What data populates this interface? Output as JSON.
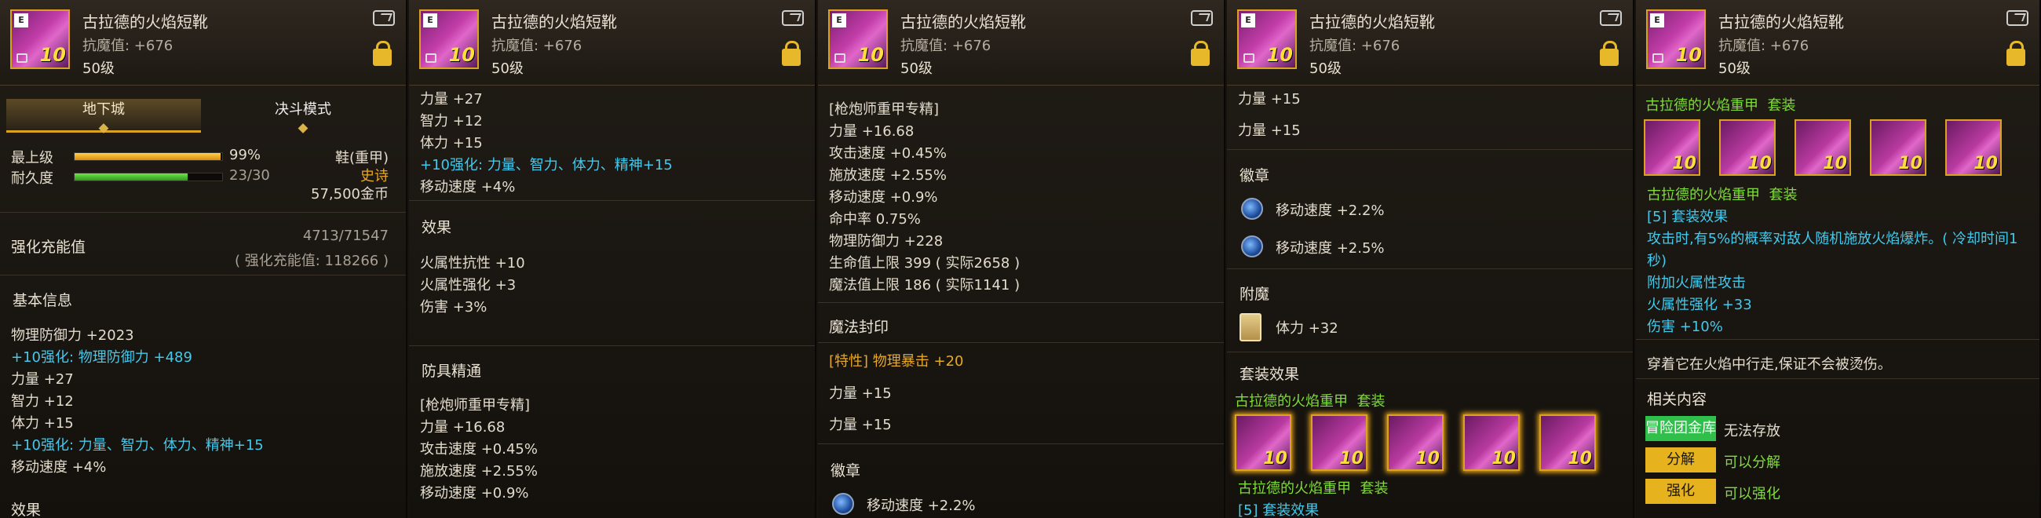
{
  "item": {
    "name": "古拉德的火焰短靴",
    "resist": "抗魔值: +676",
    "level": "50级",
    "enhance_badge": "10"
  },
  "panel1": {
    "tab_dungeon": "地下城",
    "tab_duel": "决斗模式",
    "grade_label": "最上级",
    "grade_pct": "99%",
    "grade_value": 0.99,
    "durability_label": "耐久度",
    "durability": "23/30",
    "durability_value": 0.7667,
    "type": "鞋(重甲)",
    "rarity": "史诗",
    "price": "57,500金币",
    "charge_label": "强化充能值",
    "charge_value": "4713/71547",
    "charge_note": "( 强化充能值: 118266 )",
    "basic_title": "基本信息",
    "stats": [
      "物理防御力 +2023",
      "+10强化: 物理防御力 +489",
      "力量 +27",
      "智力 +12",
      "体力 +15",
      "+10强化: 力量、智力、体力、精神+15",
      "移动速度 +4%"
    ],
    "cut_title": "效果"
  },
  "panel2": {
    "stats": [
      "力量 +27",
      "智力 +12",
      "体力 +15",
      "+10强化: 力量、智力、体力、精神+15",
      "移动速度 +4%"
    ],
    "effect_title": "效果",
    "effects": [
      "火属性抗性 +10",
      "火属性强化 +3",
      "伤害 +3%"
    ],
    "mastery_title": "防具精通",
    "mastery_sub": "[枪炮师重甲专精]",
    "mastery": [
      "力量 +16.68",
      "攻击速度 +0.45%",
      "施放速度 +2.55%",
      "移动速度 +0.9%"
    ]
  },
  "panel3": {
    "mastery_sub": "[枪炮师重甲专精]",
    "mastery": [
      "力量 +16.68",
      "攻击速度 +0.45%",
      "施放速度 +2.55%",
      "移动速度 +0.9%",
      "命中率 0.75%",
      "物理防御力 +228",
      "生命值上限 399 ( 实际2658 )",
      "魔法值上限 186 ( 实际1141 )"
    ],
    "seal_title": "魔法封印",
    "seal_trait": "[特性] 物理暴击 +20",
    "seal": [
      "力量 +15",
      "力量 +15"
    ],
    "emblem_title": "徽章",
    "emblem_cut": "移动速度 +2.2%"
  },
  "panel4": {
    "seal": [
      "力量 +15",
      "力量 +15"
    ],
    "emblem_title": "徽章",
    "emblems": [
      "移动速度 +2.2%",
      "移动速度 +2.5%"
    ],
    "enchant_title": "附魔",
    "enchant": "体力 +32",
    "set_title": "套装效果",
    "set_name": "古拉德的火焰重甲",
    "set_label": "套装",
    "set_name2": "古拉德的火焰重甲",
    "set_label2": "套装",
    "set_cut": "[5] 套装效果"
  },
  "panel5": {
    "set_name": "古拉德的火焰重甲",
    "set_label": "套装",
    "set_name2": "古拉德的火焰重甲",
    "set_label2": "套装",
    "set_effect_title": "[5] 套装效果",
    "set_effect_1": "攻击时,有5%的概率对敌人随机施放火焰爆炸。( 冷却时间1",
    "set_effect_1b": "秒)",
    "set_effect_2": "附加火属性攻击",
    "set_effect_3": "火属性强化 +33",
    "set_effect_4": "伤害 +10%",
    "flavor": "穿着它在火焰中行走,保证不会被烫伤。",
    "related_title": "相关内容",
    "btn_bank": "冒险团金库",
    "bank_text": "无法存放",
    "btn_decompose": "分解",
    "decompose_text": "可以分解",
    "btn_enhance": "强化",
    "enhance_text": "可以强化"
  }
}
